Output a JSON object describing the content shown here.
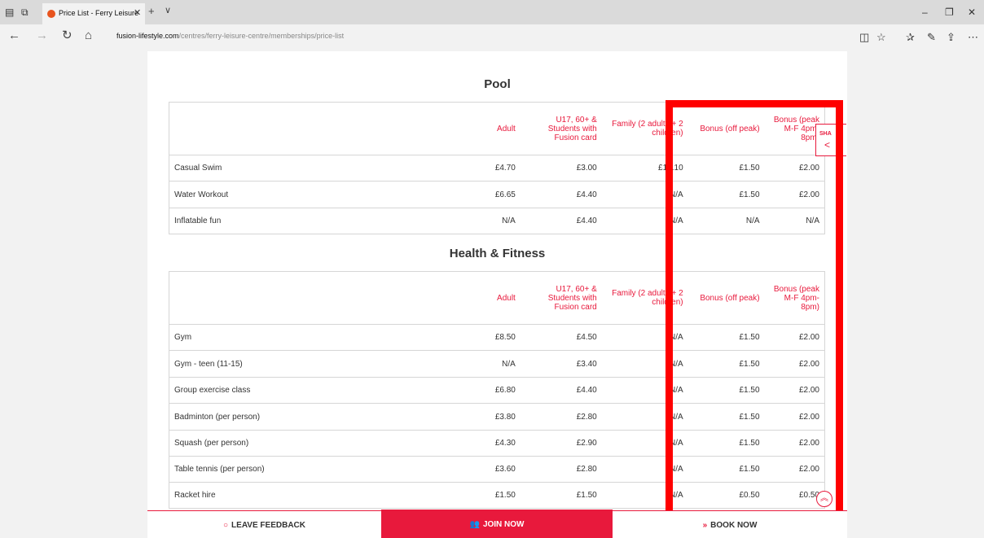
{
  "browser": {
    "tab_title": "Price List - Ferry Leisure",
    "url_host": "fusion-lifestyle.com",
    "url_path": "/centres/ferry-leisure-centre/memberships/price-list"
  },
  "share": {
    "label": "SHA"
  },
  "pool": {
    "title": "Pool",
    "headers": [
      "Adult",
      "U17, 60+ & Students with Fusion card",
      "Family (2 adults + 2 children)",
      "Bonus (off peak)",
      "Bonus (peak M-F 4pm-8pm)"
    ],
    "rows": [
      [
        "Casual Swim",
        "£4.70",
        "£3.00",
        "£12.10",
        "£1.50",
        "£2.00"
      ],
      [
        "Water Workout",
        "£6.65",
        "£4.40",
        "N/A",
        "£1.50",
        "£2.00"
      ],
      [
        "Inflatable fun",
        "N/A",
        "£4.40",
        "N/A",
        "N/A",
        "N/A"
      ]
    ]
  },
  "health": {
    "title": "Health & Fitness",
    "headers": [
      "Adult",
      "U17, 60+ & Students with Fusion card",
      "Family (2 adults + 2 children)",
      "Bonus (off peak)",
      "Bonus (peak M-F 4pm-8pm)"
    ],
    "rows": [
      [
        "Gym",
        "£8.50",
        "£4.50",
        "N/A",
        "£1.50",
        "£2.00"
      ],
      [
        "Gym - teen (11-15)",
        "N/A",
        "£3.40",
        "N/A",
        "£1.50",
        "£2.00"
      ],
      [
        "Group exercise class",
        "£6.80",
        "£4.40",
        "N/A",
        "£1.50",
        "£2.00"
      ],
      [
        "Badminton (per person)",
        "£3.80",
        "£2.80",
        "N/A",
        "£1.50",
        "£2.00"
      ],
      [
        "Squash (per person)",
        "£4.30",
        "£2.90",
        "N/A",
        "£1.50",
        "£2.00"
      ],
      [
        "Table tennis (per person)",
        "£3.60",
        "£2.80",
        "N/A",
        "£1.50",
        "£2.00"
      ],
      [
        "Racket hire",
        "£1.50",
        "£1.50",
        "N/A",
        "£0.50",
        "£0.50"
      ]
    ]
  },
  "bottom_bar": {
    "feedback": "LEAVE FEEDBACK",
    "join": "JOIN NOW",
    "book": "BOOK NOW"
  },
  "colors": {
    "accent": "#e8193c",
    "highlight": "#ff0000"
  }
}
